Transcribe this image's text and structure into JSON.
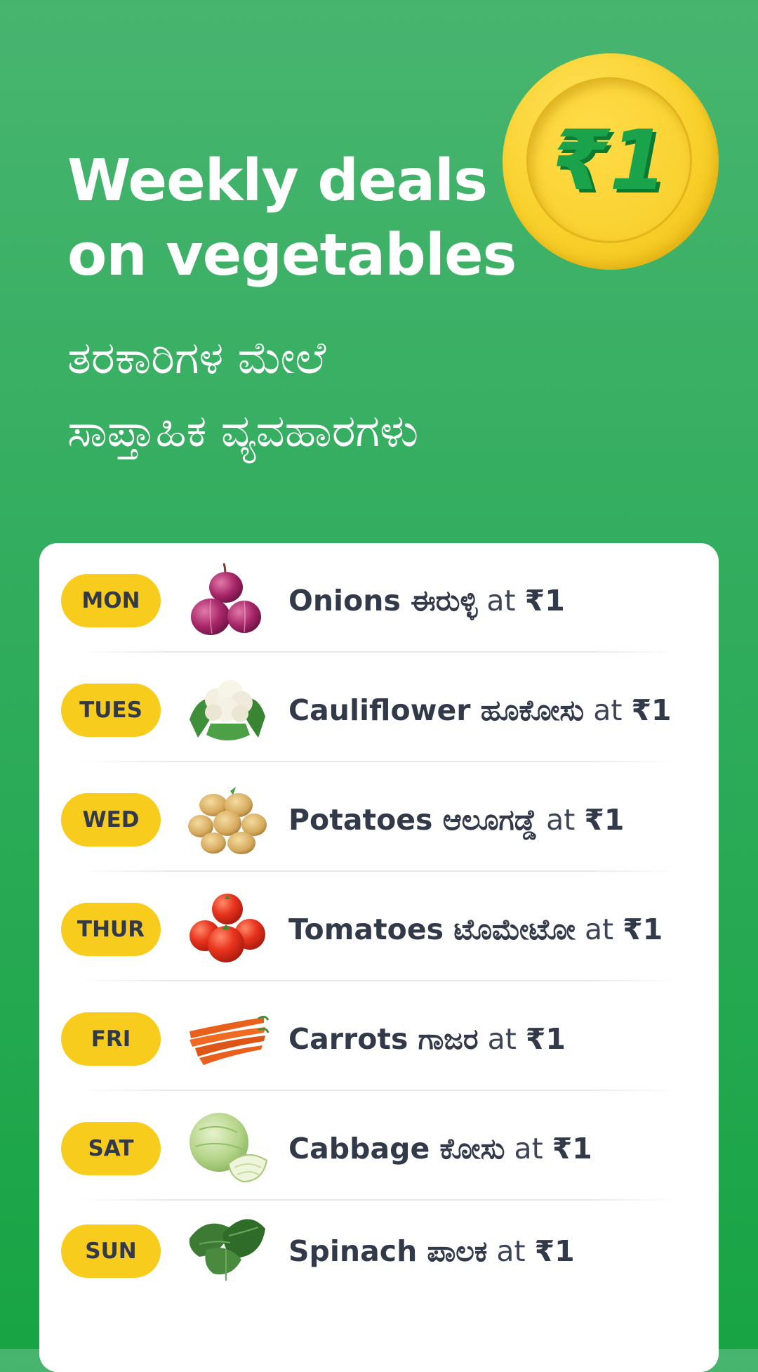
{
  "headline": {
    "line1": "Weekly deals",
    "line2": "on vegetables"
  },
  "subline": {
    "line1": "ತರಕಾರಿಗಳ ಮೇಲೆ",
    "line2": "ಸಾಪ್ತಾಹಿಕ ವ್ಯವಹಾರಗಳು"
  },
  "coin": {
    "text": "₹1",
    "icon": "rupee-coin-icon"
  },
  "colors": {
    "background": "#2fac5c",
    "coin": "#f9d12c",
    "pill": "#f8cc1d",
    "text": "#323a4a"
  },
  "deals": [
    {
      "day": "MON",
      "name": "Onions ಈರುಳ್ಳಿ",
      "at": "at",
      "price": "₹1",
      "icon": "onion-icon"
    },
    {
      "day": "TUES",
      "name": "Cauliflower ಹೂಕೋಸು",
      "at": "at",
      "price": "₹1",
      "icon": "cauliflower-icon"
    },
    {
      "day": "WED",
      "name": "Potatoes ಆಲೂಗಡ್ಡೆ",
      "at": "at",
      "price": "₹1",
      "icon": "potato-icon"
    },
    {
      "day": "THUR",
      "name": "Tomatoes ಟೊಮೇಟೋ",
      "at": "at",
      "price": "₹1",
      "icon": "tomato-icon"
    },
    {
      "day": "FRI",
      "name": "Carrots ಗಾಜರ",
      "at": "at",
      "price": "₹1",
      "icon": "carrot-icon"
    },
    {
      "day": "SAT",
      "name": "Cabbage ಕೋಸು",
      "at": "at",
      "price": "₹1",
      "icon": "cabbage-icon"
    },
    {
      "day": "SUN",
      "name": "Spinach ಪಾಲಕ",
      "at": "at",
      "price": "₹1",
      "icon": "spinach-icon"
    }
  ]
}
